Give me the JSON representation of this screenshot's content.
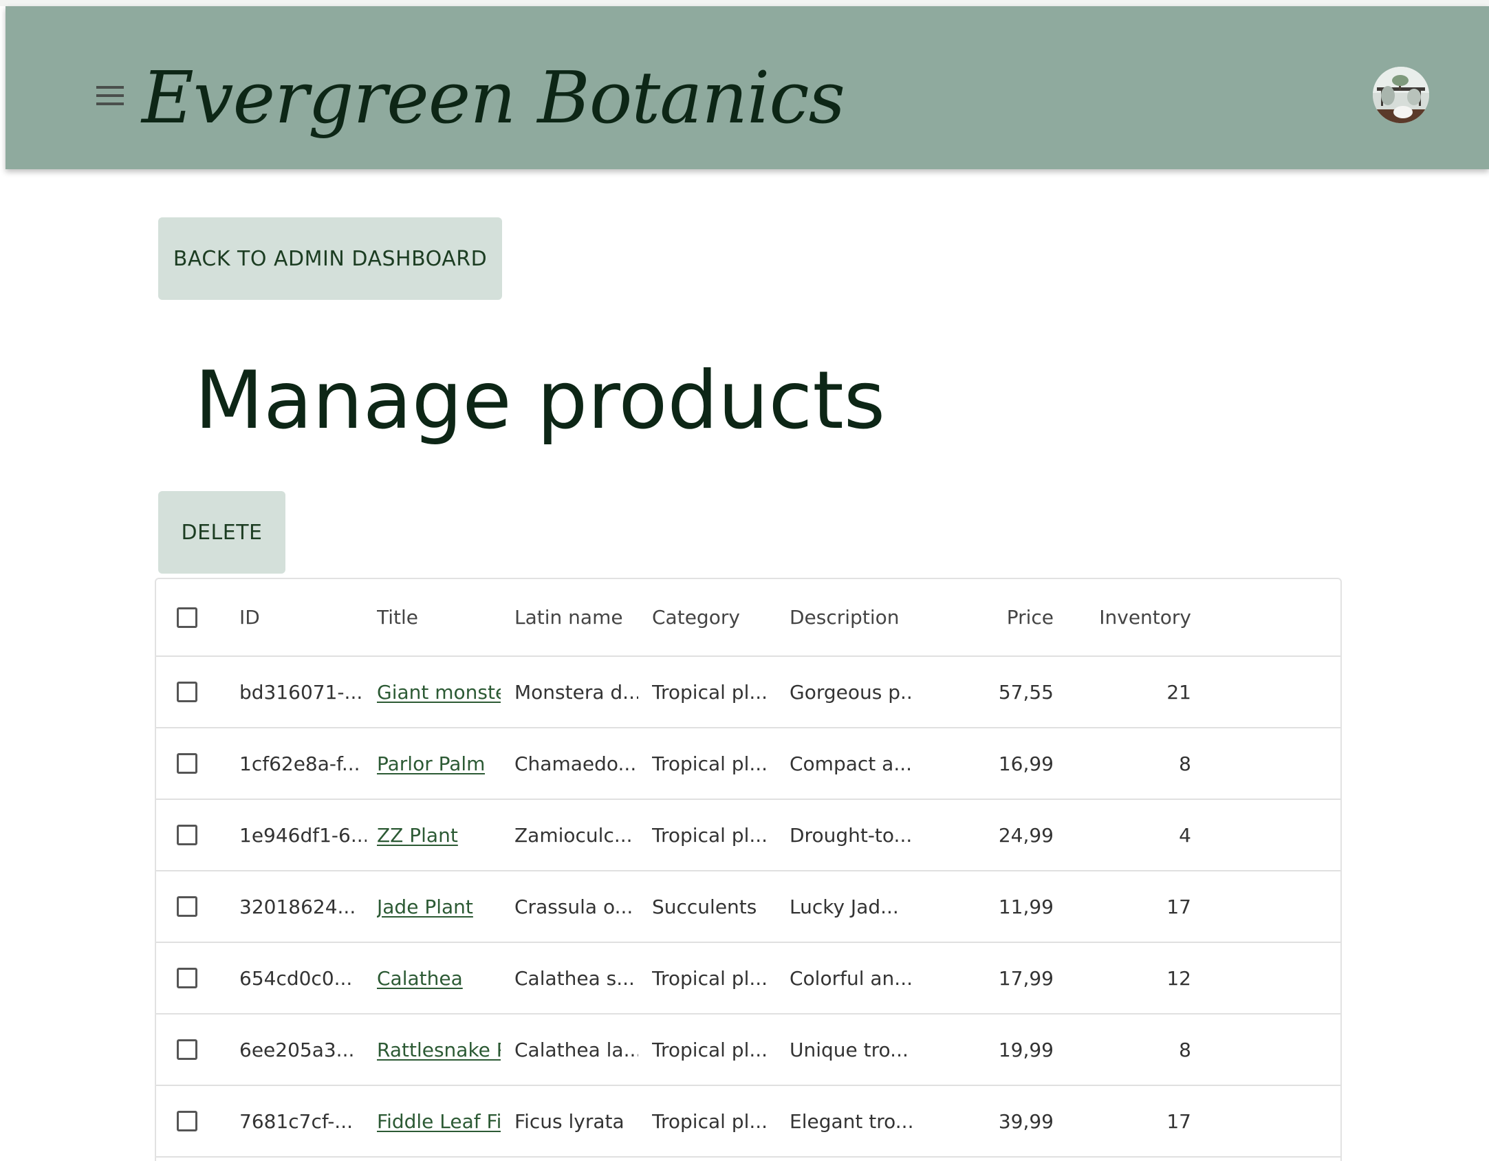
{
  "header": {
    "brand": "Evergreen Botanics",
    "menu_icon": "hamburger-menu-icon",
    "avatar_icon": "user-avatar"
  },
  "main": {
    "back_label": "BACK TO ADMIN DASHBOARD",
    "title": "Manage products",
    "delete_label": "DELETE"
  },
  "table": {
    "columns": {
      "id": "ID",
      "title": "Title",
      "latin": "Latin name",
      "category": "Category",
      "description": "Description",
      "price": "Price",
      "inventory": "Inventory"
    },
    "rows": [
      {
        "id": "bd316071-...",
        "title": "Giant monstera",
        "latin": "Monstera d...",
        "category": "Tropical pl...",
        "description": "Gorgeous p...",
        "price": "57,55",
        "inventory": "21"
      },
      {
        "id": "1cf62e8a-f...",
        "title": "Parlor Palm",
        "latin": "Chamaedo...",
        "category": "Tropical pl...",
        "description": "Compact a...",
        "price": "16,99",
        "inventory": "8"
      },
      {
        "id": "1e946df1-6...",
        "title": "ZZ Plant",
        "latin": "Zamioculc...",
        "category": "Tropical pl...",
        "description": "Drought-to...",
        "price": "24,99",
        "inventory": "4"
      },
      {
        "id": "32018624...",
        "title": "Jade Plant",
        "latin": "Crassula o...",
        "category": "Succulents",
        "description": "Lucky Jad...",
        "price": "11,99",
        "inventory": "17"
      },
      {
        "id": "654cd0c0...",
        "title": "Calathea",
        "latin": "Calathea s...",
        "category": "Tropical pl...",
        "description": "Colorful an...",
        "price": "17,99",
        "inventory": "12"
      },
      {
        "id": "6ee205a3...",
        "title": "Rattlesnake Plant",
        "latin": "Calathea la...",
        "category": "Tropical pl...",
        "description": "Unique tro...",
        "price": "19,99",
        "inventory": "8"
      },
      {
        "id": "7681c7cf-...",
        "title": "Fiddle Leaf Fig",
        "latin": "Ficus lyrata",
        "category": "Tropical pl...",
        "description": "Elegant tro...",
        "price": "39,99",
        "inventory": "17"
      }
    ]
  },
  "colors": {
    "appbar": "#8faa9e",
    "button_bg": "#d4e0da",
    "heading_text": "#0d2616",
    "link": "#2c5a34"
  }
}
